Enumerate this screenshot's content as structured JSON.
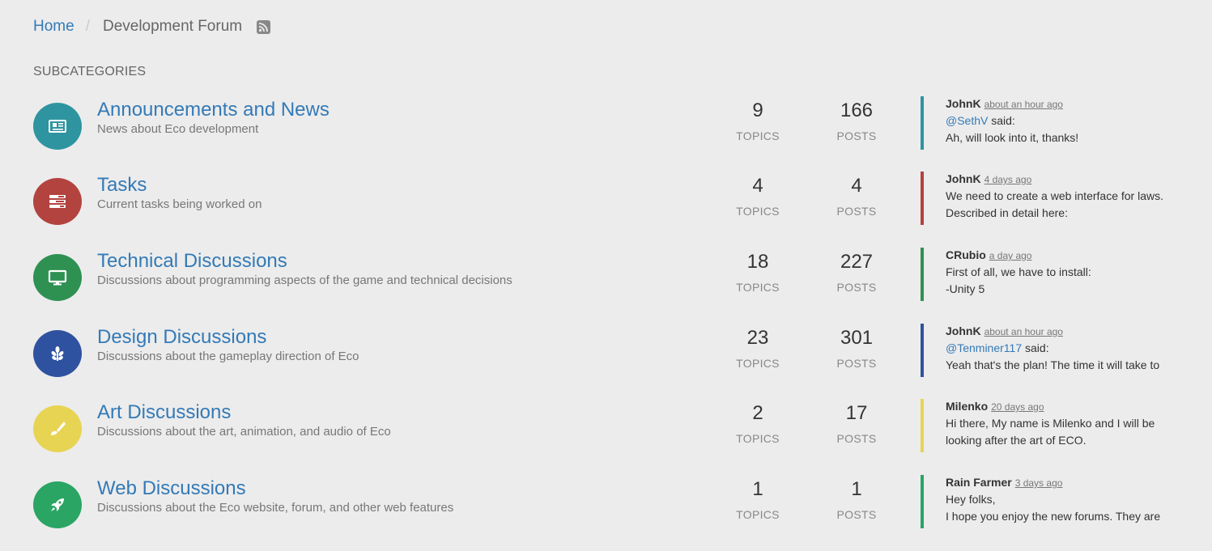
{
  "breadcrumb": {
    "home": "Home",
    "separator": "/",
    "current": "Development Forum"
  },
  "subcategories_title": "SUBCATEGORIES",
  "categories": [
    {
      "name": "Announcements and News",
      "description": "News about Eco development",
      "icon": "newspaper-icon",
      "color": "#2e94a0",
      "topics": "9",
      "topics_label": "TOPICS",
      "posts": "166",
      "posts_label": "POSTS",
      "teaser": {
        "user": "JohnK",
        "time": "about an hour ago",
        "mention": "@SethV",
        "line1_rest": " said:",
        "line2": "Ah, will look into it, thanks!"
      }
    },
    {
      "name": "Tasks",
      "description": "Current tasks being worked on",
      "icon": "tasks-icon",
      "color": "#b3433f",
      "topics": "4",
      "topics_label": "TOPICS",
      "posts": "4",
      "posts_label": "POSTS",
      "teaser": {
        "user": "JohnK",
        "time": "4 days ago",
        "mention": "",
        "line1_rest": "We need to create a web interface for laws.",
        "line2": "Described in detail here:"
      }
    },
    {
      "name": "Technical Discussions",
      "description": "Discussions about programming aspects of the game and technical decisions",
      "icon": "desktop-icon",
      "color": "#2e9152",
      "topics": "18",
      "topics_label": "TOPICS",
      "posts": "227",
      "posts_label": "POSTS",
      "teaser": {
        "user": "CRubio",
        "time": "a day ago",
        "mention": "",
        "line1_rest": "First of all, we have to install:",
        "line2": "-Unity 5"
      }
    },
    {
      "name": "Design Discussions",
      "description": "Discussions about the gameplay direction of Eco",
      "icon": "leaf-icon",
      "color": "#2f52a0",
      "topics": "23",
      "topics_label": "TOPICS",
      "posts": "301",
      "posts_label": "POSTS",
      "teaser": {
        "user": "JohnK",
        "time": "about an hour ago",
        "mention": "@Tenminer117",
        "line1_rest": " said:",
        "line2": "Yeah that's the plan! The time it will take to"
      }
    },
    {
      "name": "Art Discussions",
      "description": "Discussions about the art, animation, and audio of Eco",
      "icon": "paintbrush-icon",
      "color": "#e8d453",
      "topics": "2",
      "topics_label": "TOPICS",
      "posts": "17",
      "posts_label": "POSTS",
      "teaser": {
        "user": "Milenko",
        "time": "20 days ago",
        "mention": "",
        "line1_rest": "Hi there, My name is Milenko and I will be",
        "line2": "looking after the art of ECO."
      }
    },
    {
      "name": "Web Discussions",
      "description": "Discussions about the Eco website, forum, and other web features",
      "icon": "rocket-icon",
      "color": "#2aa564",
      "topics": "1",
      "topics_label": "TOPICS",
      "posts": "1",
      "posts_label": "POSTS",
      "teaser": {
        "user": "Rain Farmer",
        "time": "3 days ago",
        "mention": "",
        "line1_rest": "Hey folks,",
        "line2": "I hope you enjoy the new forums. They are"
      }
    }
  ]
}
